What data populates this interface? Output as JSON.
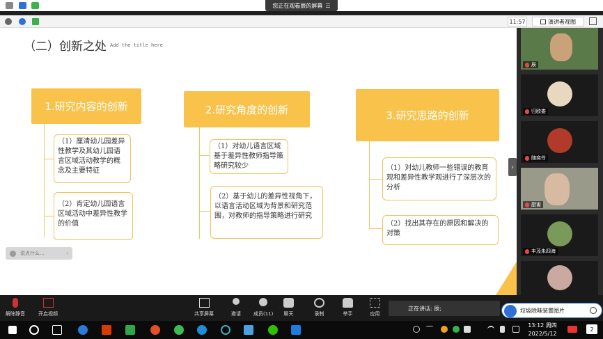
{
  "share_banner": {
    "text": "您正在观看辰的屏幕",
    "menu_icon": "menu-icon"
  },
  "info_bar": {
    "time": "11:57",
    "view_label": "演讲者视图"
  },
  "slide": {
    "title": "（二）创新之处",
    "hint": "Add the title here",
    "sections": [
      {
        "heading": "1.研究内容的创新",
        "items": [
          "（1）厘清幼儿园差异性教学及其幼儿园语言区域活动教学的概念及主要特征",
          "（2）肯定幼儿园语言区域活动中差异性教学的价值"
        ]
      },
      {
        "heading": "2.研究角度的创新",
        "items": [
          "（1）对幼儿语言区域基于差异性教师指导策略研究较少",
          "（2）基于幼儿的差异性视角下，以语言活动区域为背景和研究范围，对教师的指导策略进行研究"
        ]
      },
      {
        "heading": "3.研究思路的创新",
        "items": [
          "（1）对幼儿教师一些错误的教育观和差异性教学观进行了深层次的分析",
          "（2）找出其存在的原因和解决的对策"
        ]
      }
    ],
    "comment_placeholder": "说点什么...",
    "accent_color": "#f9c24a"
  },
  "gallery": {
    "participants": [
      {
        "name": "辰"
      },
      {
        "name": "归欧娄"
      },
      {
        "name": "随奕伶"
      },
      {
        "name": "厨害"
      },
      {
        "name": "丰茂朱四海"
      },
      {
        "name": ""
      }
    ]
  },
  "toolbar": {
    "mute": "解除静音",
    "video": "开启视频",
    "share": "共享屏幕",
    "invite": "邀请",
    "members": "成员(11)",
    "chat": "聊天",
    "record": "录制",
    "raise_hand": "举手",
    "apps": "应用",
    "speaking": "正在讲话: 辰;"
  },
  "notification": {
    "text": "垃圾除昧装置图片"
  },
  "taskbar": {
    "time": "13:12 周四",
    "date": "2022/5/12",
    "badge": "2"
  }
}
